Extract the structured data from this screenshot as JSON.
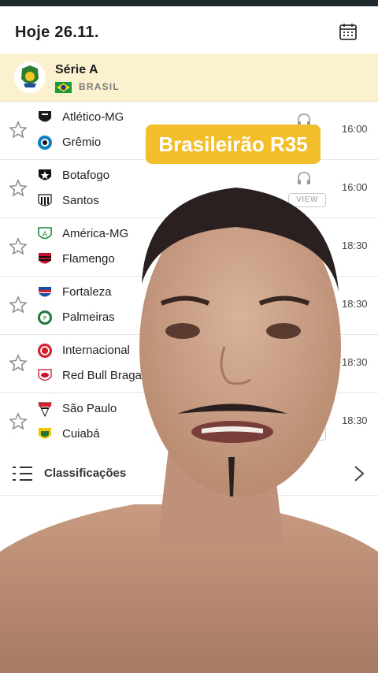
{
  "header": {
    "date": "Hoje 26.11.",
    "calendar_icon": "calendar-icon"
  },
  "league": {
    "name": "Série A",
    "country": "BRASIL",
    "logo_icon": "brasileirao-logo",
    "flag_icon": "brazil-flag-icon"
  },
  "matches": [
    {
      "home": "Atlético-MG",
      "away": "Grêmio",
      "time": "16:00",
      "audio": true,
      "preview": ""
    },
    {
      "home": "Botafogo",
      "away": "Santos",
      "time": "16:00",
      "audio": true,
      "preview": "VIEW"
    },
    {
      "home": "América-MG",
      "away": "Flamengo",
      "time": "18:30",
      "audio": false,
      "preview": ""
    },
    {
      "home": "Fortaleza",
      "away": "Palmeiras",
      "time": "18:30",
      "audio": false,
      "preview": ""
    },
    {
      "home": "Internacional",
      "away": "Red Bull Bragantino",
      "time": "18:30",
      "audio": false,
      "preview": ""
    },
    {
      "home": "São Paulo",
      "away": "Cuiabá",
      "time": "18:30",
      "audio": false,
      "preview": "W"
    }
  ],
  "standings": {
    "label": "Classificações",
    "icon": "standings-list-icon"
  },
  "overlay": {
    "badge": "Brasileirão R35"
  },
  "colors": {
    "league_bg": "#fbf1cf",
    "badge_bg": "#f3be2b",
    "topbar": "#1d2a2e"
  }
}
